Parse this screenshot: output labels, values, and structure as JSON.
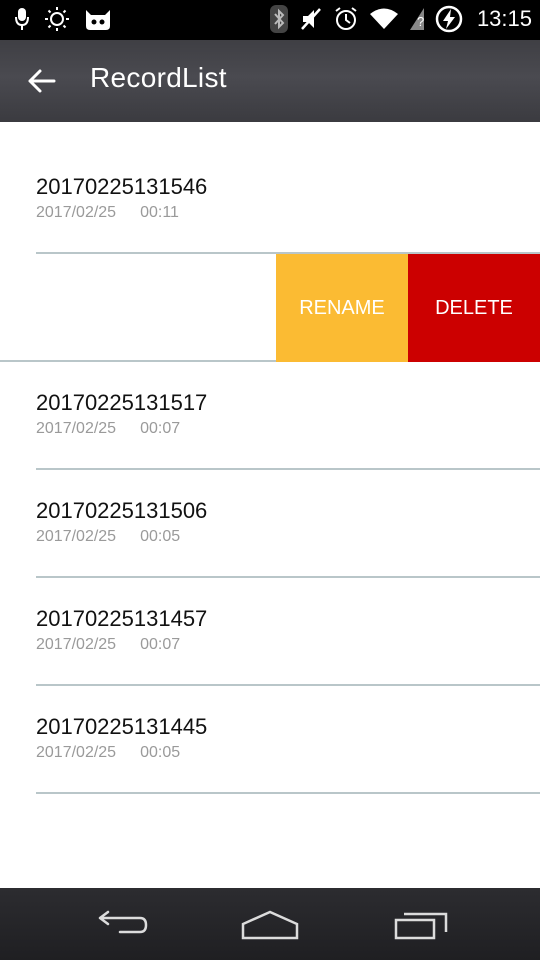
{
  "status_bar": {
    "time": "13:15",
    "icons_left": [
      "mic-icon",
      "brightness-icon",
      "cyanogen-icon"
    ],
    "icons_right": [
      "bluetooth-icon",
      "muted-icon",
      "alarm-icon",
      "wifi-icon",
      "signal-icon",
      "battery-charging-icon"
    ]
  },
  "app_bar": {
    "title": "RecordList"
  },
  "records": [
    {
      "name": "20170225131546",
      "date": "2017/02/25",
      "duration": "00:11"
    },
    {
      "name": "20170225131517",
      "date": "2017/02/25",
      "duration": "00:07"
    },
    {
      "name": "20170225131506",
      "date": "2017/02/25",
      "duration": "00:05"
    },
    {
      "name": "20170225131457",
      "date": "2017/02/25",
      "duration": "00:07"
    },
    {
      "name": "20170225131445",
      "date": "2017/02/25",
      "duration": "00:05"
    }
  ],
  "swipe_actions": {
    "rename_label": "RENAME",
    "delete_label": "DELETE",
    "rename_color": "#fbbb33",
    "delete_color": "#cc0000"
  },
  "nav_bar": {
    "buttons": [
      "back-icon",
      "home-icon",
      "recents-icon"
    ]
  }
}
